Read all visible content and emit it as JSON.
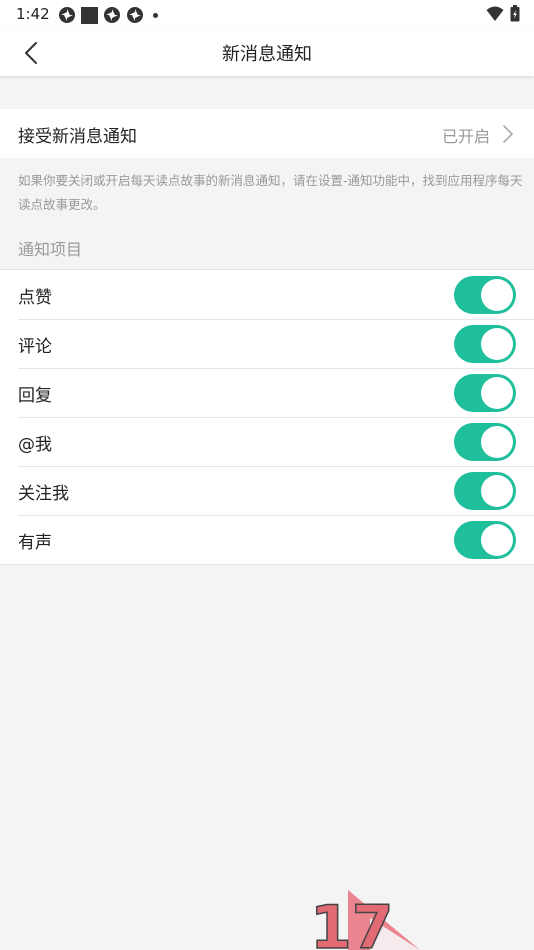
{
  "status_bar": {
    "time": "1:42"
  },
  "nav": {
    "title": "新消息通知"
  },
  "accept": {
    "label": "接受新消息通知",
    "status": "已开启"
  },
  "hint": "如果你要关闭或开启每天读点故事的新消息通知，请在设置-通知功能中，找到应用程序每天读点故事更改。",
  "section_title": "通知项目",
  "items": [
    {
      "label": "点赞",
      "enabled": true
    },
    {
      "label": "评论",
      "enabled": true
    },
    {
      "label": "回复",
      "enabled": true
    },
    {
      "label": "@我",
      "enabled": true
    },
    {
      "label": "关注我",
      "enabled": true
    },
    {
      "label": "有声",
      "enabled": true
    }
  ],
  "colors": {
    "toggle_on": "#1fbf9c",
    "background": "#f4f4f4"
  },
  "watermark_text": "17"
}
